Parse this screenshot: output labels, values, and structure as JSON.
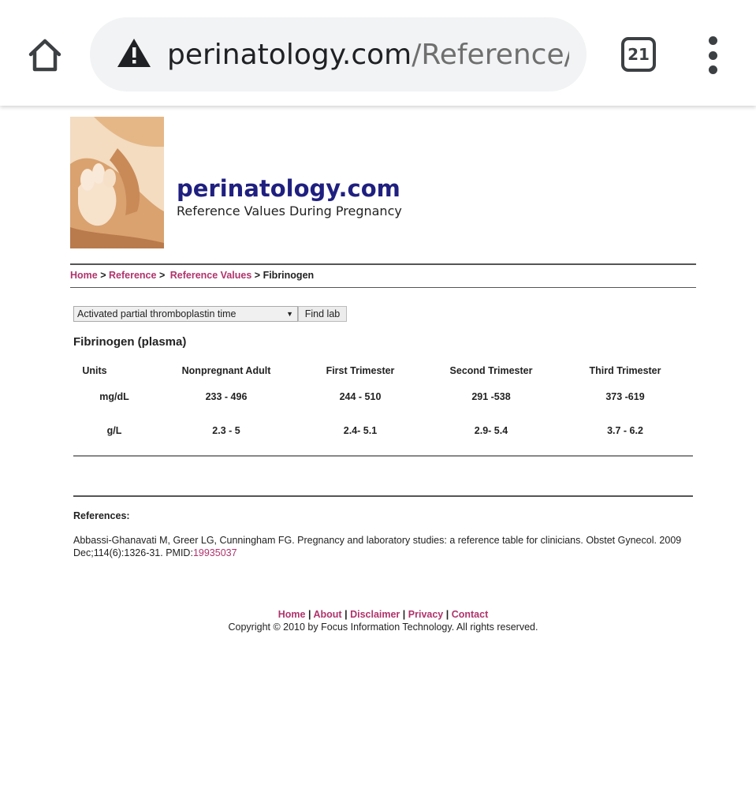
{
  "browser": {
    "url_host": "perinatology.com",
    "url_path": "/Reference/F",
    "tab_count": "21",
    "icons": [
      "home-icon",
      "warning-icon",
      "tabs-icon",
      "more-vert-icon"
    ]
  },
  "site": {
    "title": "perinatology.com",
    "subtitle": "Reference Values During Pregnancy",
    "link_color": "#b0336c",
    "title_color": "#1f1f80"
  },
  "breadcrumb": {
    "home": "Home",
    "sep1": ">",
    "reference": "Reference",
    "sep2": ">",
    "reference_values": "Reference Values",
    "sep3": ">",
    "current": "Fibrinogen"
  },
  "lab_select": {
    "selected": "Activated partial thromboplastin time",
    "button": "Find lab"
  },
  "table": {
    "title": "Fibrinogen (plasma)",
    "headers": [
      "Units",
      "Nonpregnant Adult",
      "First Trimester",
      "Second Trimester",
      "Third Trimester"
    ],
    "rows": [
      [
        "mg/dL",
        "233 - 496",
        "244 - 510",
        "291 -538",
        "373 -619"
      ],
      [
        "g/L",
        "2.3 - 5",
        "2.4- 5.1",
        "2.9- 5.4",
        "3.7 - 6.2"
      ]
    ]
  },
  "references": {
    "title": "References:",
    "citation": "Abbassi-Ghanavati M, Greer LG, Cunningham FG. Pregnancy and laboratory studies: a reference table for clinicians. Obstet Gynecol. 2009 Dec;114(6):1326-31. PMID:",
    "pmid": "19935037"
  },
  "footer": {
    "links": [
      "Home",
      "About",
      "Disclaimer",
      "Privacy",
      "Contact"
    ],
    "separator": "|",
    "copyright": "Copyright © 2010 by Focus Information Technology. All rights reserved."
  }
}
